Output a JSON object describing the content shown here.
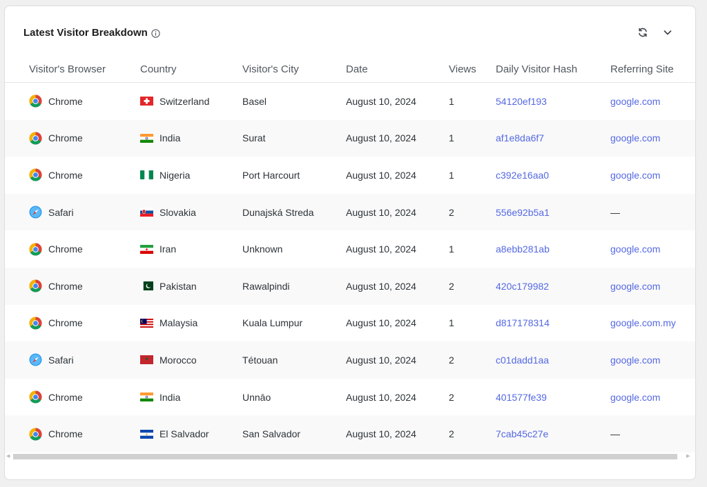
{
  "card": {
    "title": "Latest Visitor Breakdown"
  },
  "icons": {
    "info": "info-icon",
    "refresh": "refresh-icon",
    "collapse": "chevron-down-icon"
  },
  "columns": [
    "Visitor's Browser",
    "Country",
    "Visitor's City",
    "Date",
    "Views",
    "Daily Visitor Hash",
    "Referring Site"
  ],
  "rows": [
    {
      "browser": "Chrome",
      "country": "Switzerland",
      "flag": "switzerland",
      "city": "Basel",
      "date": "August 10, 2024",
      "views": "1",
      "hash": "54120ef193",
      "referrer": "google.com"
    },
    {
      "browser": "Chrome",
      "country": "India",
      "flag": "india",
      "city": "Surat",
      "date": "August 10, 2024",
      "views": "1",
      "hash": "af1e8da6f7",
      "referrer": "google.com"
    },
    {
      "browser": "Chrome",
      "country": "Nigeria",
      "flag": "nigeria",
      "city": "Port Harcourt",
      "date": "August 10, 2024",
      "views": "1",
      "hash": "c392e16aa0",
      "referrer": "google.com"
    },
    {
      "browser": "Safari",
      "country": "Slovakia",
      "flag": "slovakia",
      "city": "Dunajská Streda",
      "date": "August 10, 2024",
      "views": "2",
      "hash": "556e92b5a1",
      "referrer": "—"
    },
    {
      "browser": "Chrome",
      "country": "Iran",
      "flag": "iran",
      "city": "Unknown",
      "date": "August 10, 2024",
      "views": "1",
      "hash": "a8ebb281ab",
      "referrer": "google.com"
    },
    {
      "browser": "Chrome",
      "country": "Pakistan",
      "flag": "pakistan",
      "city": "Rawalpindi",
      "date": "August 10, 2024",
      "views": "2",
      "hash": "420c179982",
      "referrer": "google.com"
    },
    {
      "browser": "Chrome",
      "country": "Malaysia",
      "flag": "malaysia",
      "city": "Kuala Lumpur",
      "date": "August 10, 2024",
      "views": "1",
      "hash": "d817178314",
      "referrer": "google.com.my"
    },
    {
      "browser": "Safari",
      "country": "Morocco",
      "flag": "morocco",
      "city": "Tétouan",
      "date": "August 10, 2024",
      "views": "2",
      "hash": "c01dadd1aa",
      "referrer": "google.com"
    },
    {
      "browser": "Chrome",
      "country": "India",
      "flag": "india",
      "city": "Unnāo",
      "date": "August 10, 2024",
      "views": "2",
      "hash": "401577fe39",
      "referrer": "google.com"
    },
    {
      "browser": "Chrome",
      "country": "El Salvador",
      "flag": "el-salvador",
      "city": "San Salvador",
      "date": "August 10, 2024",
      "views": "2",
      "hash": "7cab45c27e",
      "referrer": "—"
    }
  ],
  "colors": {
    "link": "#5468e4",
    "header_text": "#50575e",
    "body_text": "#2c3338",
    "row_alt": "#f9f9f9"
  }
}
